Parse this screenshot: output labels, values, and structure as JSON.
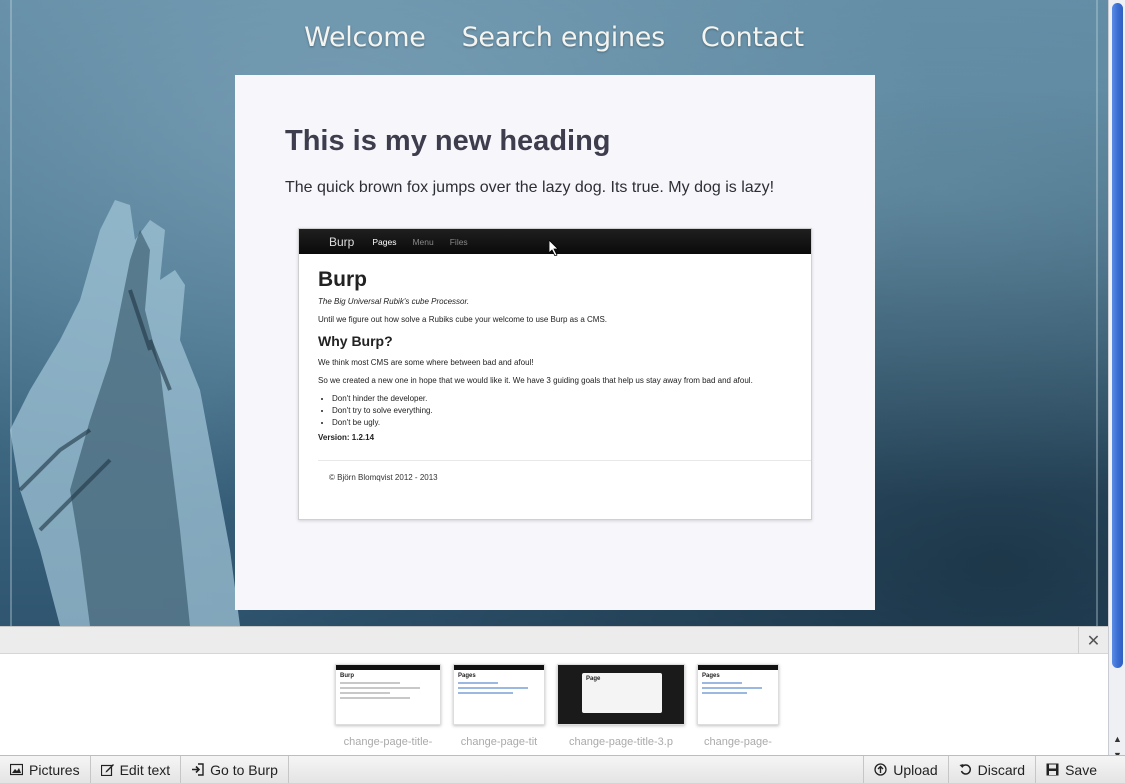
{
  "nav": {
    "items": [
      "Welcome",
      "Search engines",
      "Contact"
    ]
  },
  "page": {
    "heading": "This is my new heading",
    "intro": "The quick brown fox jumps over the lazy dog. Its true. My dog is lazy!"
  },
  "embedded_screenshot": {
    "brand": "Burp",
    "menu": [
      "Pages",
      "Menu",
      "Files"
    ],
    "active_menu": "Pages",
    "title": "Burp",
    "tagline": "The Big Universal Rubik's cube Processor.",
    "line1": "Until we figure out how solve a Rubiks cube your welcome to use Burp as a CMS.",
    "subtitle": "Why Burp?",
    "line2": "We think most CMS are some where between bad and afoul!",
    "line3": "So we created a new one in hope that we would like it. We have 3 guiding goals that help us stay away from bad and afoul.",
    "goals": [
      "Don't hinder the developer.",
      "Don't try to solve everything.",
      "Don't be ugly."
    ],
    "version": "Version: 1.2.14",
    "footer": "© Björn Blomqvist 2012 - 2013"
  },
  "tray": {
    "close_icon": "✕",
    "thumbnails": [
      {
        "caption": "change-page-title-",
        "thumb_title": "Burp"
      },
      {
        "caption": "change-page-tit",
        "thumb_title": "Pages"
      },
      {
        "caption": "change-page-title-3.p",
        "thumb_title": "Page"
      },
      {
        "caption": "change-page-",
        "thumb_title": "Pages"
      }
    ]
  },
  "toolbar": {
    "pictures": "Pictures",
    "edit_text": "Edit text",
    "go_to_burp": "Go to Burp",
    "upload": "Upload",
    "discard": "Discard",
    "save": "Save"
  },
  "icons": {
    "pictures": "picture-icon",
    "edit_text": "edit-icon",
    "go_to_burp": "login-arrow-icon",
    "upload": "upload-icon",
    "discard": "undo-icon",
    "save": "floppy-disk-icon"
  },
  "colors": {
    "card_bg": "#f6f6fb",
    "heading": "#3d3d4d",
    "scroll_thumb": "#3a6fd3"
  }
}
